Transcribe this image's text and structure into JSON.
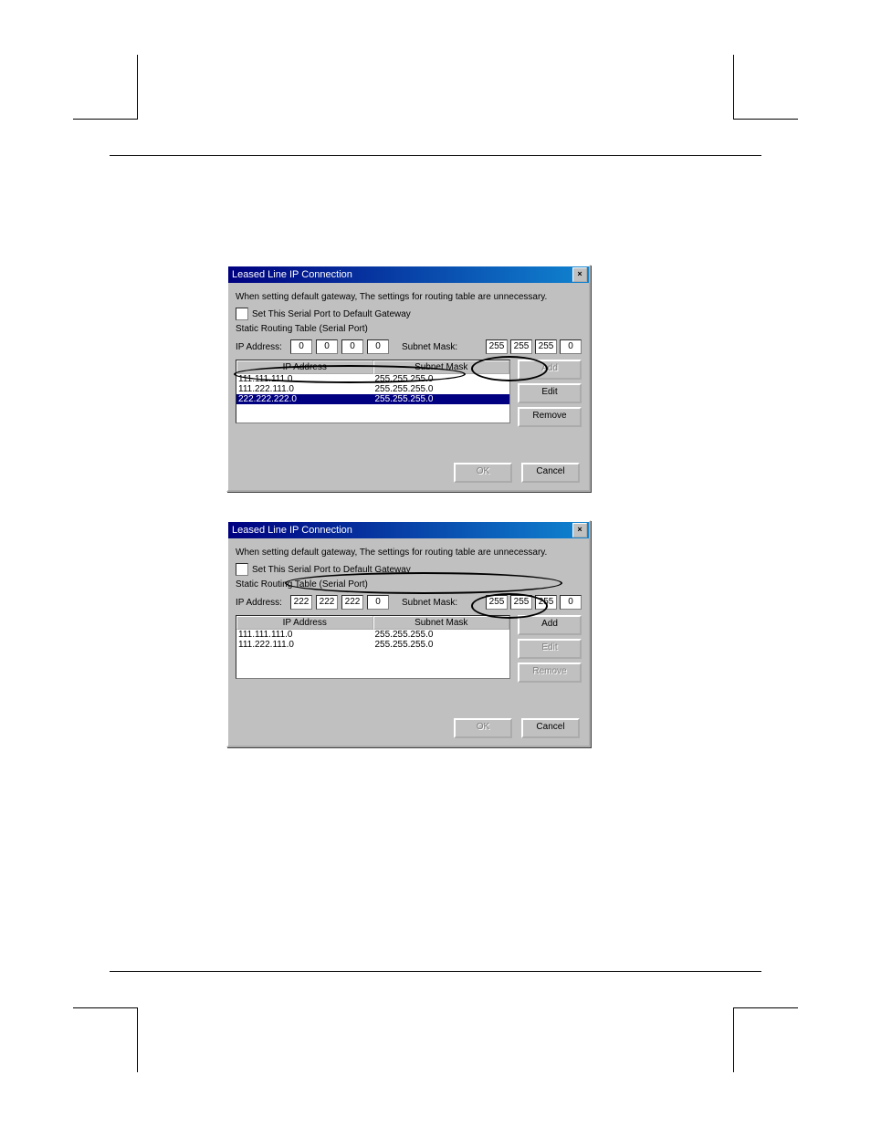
{
  "dialog1": {
    "title": "Leased Line IP Connection",
    "note": "When setting default gateway, The settings for routing table are unnecessary.",
    "checkbox_label": "Set This Serial Port to Default Gateway",
    "group_label": "Static Routing Table (Serial Port)",
    "ip_label": "IP Address:",
    "mask_label": "Subnet Mask:",
    "ip_octets": [
      "0",
      "0",
      "0",
      "0"
    ],
    "mask_octets": [
      "255",
      "255",
      "255",
      "0"
    ],
    "columns": [
      "IP Address",
      "Subnet Mask"
    ],
    "rows": [
      {
        "ip": "111.111.111.0",
        "mask": "255.255.255.0",
        "sel": false
      },
      {
        "ip": "111.222.111.0",
        "mask": "255.255.255.0",
        "sel": false
      },
      {
        "ip": "222.222.222.0",
        "mask": "255.255.255.0",
        "sel": true
      }
    ],
    "buttons": {
      "add": "Add",
      "edit": "Edit",
      "remove": "Remove"
    },
    "ok": "OK",
    "cancel": "Cancel"
  },
  "dialog2": {
    "title": "Leased Line IP Connection",
    "note": "When setting default gateway, The settings for routing table are unnecessary.",
    "checkbox_label": "Set This Serial Port to Default Gateway",
    "group_label": "Static Routing Table (Serial Port)",
    "ip_label": "IP Address:",
    "mask_label": "Subnet Mask:",
    "ip_octets": [
      "222",
      "222",
      "222",
      "0"
    ],
    "mask_octets": [
      "255",
      "255",
      "255",
      "0"
    ],
    "columns": [
      "IP Address",
      "Subnet Mask"
    ],
    "rows": [
      {
        "ip": "111.111.111.0",
        "mask": "255.255.255.0",
        "sel": false
      },
      {
        "ip": "111.222.111.0",
        "mask": "255.255.255.0",
        "sel": false
      }
    ],
    "buttons": {
      "add": "Add",
      "edit": "Edit",
      "remove": "Remove"
    },
    "ok": "OK",
    "cancel": "Cancel"
  }
}
